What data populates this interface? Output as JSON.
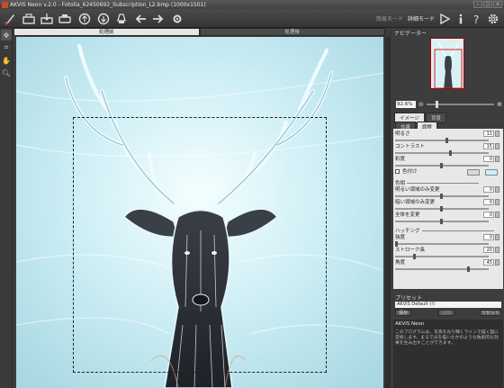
{
  "window": {
    "title": "AKVIS Neon v.2.0 - Fotolia_62450692_Subscription_L2.bmp (1000x1501)"
  },
  "toolbar": {
    "icons": [
      "logo-icon",
      "open-icon",
      "save-icon",
      "print-icon",
      "upload-icon",
      "share-icon",
      "brush-icon",
      "back-icon",
      "forward-icon",
      "run-icon",
      "info-icon",
      "help-icon",
      "settings-icon"
    ],
    "mode_simple": "簡易モード",
    "mode_advanced": "詳細モード"
  },
  "canvas_tabs": {
    "before": "処理前",
    "after": "処理後"
  },
  "navigator": {
    "title": "ナビゲーター",
    "zoom": "92.6%"
  },
  "panel_tabs": {
    "image": "イメージ",
    "background": "背景"
  },
  "sub_tabs": {
    "effect": "効果",
    "adjust": "調整"
  },
  "settings": {
    "brightness": {
      "label": "明るさ",
      "value": "11"
    },
    "contrast": {
      "label": "コントラスト",
      "value": "15"
    },
    "saturation": {
      "label": "彩度",
      "value": "0"
    },
    "tint": {
      "label": "色付け",
      "color": "#c8f0f8"
    },
    "color_section": "色相",
    "bright_hue": {
      "label": "明るい領域のみ変更",
      "value": "0"
    },
    "dark_hue": {
      "label": "暗い領域のみ変更",
      "value": "0"
    },
    "all_hue": {
      "label": "全体を変更",
      "value": "0"
    },
    "hatching_section": "ハッチング",
    "strength": {
      "label": "強度",
      "value": "0"
    },
    "stroke_length": {
      "label": "ストローク長",
      "value": "20"
    },
    "angle": {
      "label": "角度",
      "value": "45"
    }
  },
  "presets": {
    "title": "プリセット",
    "selected": "AKVIS Default (!)",
    "save": "保存",
    "delete": "削除",
    "reset": "リセット"
  },
  "info": {
    "title": "AKVIS Neon",
    "text": "このプログラムは、写真を光り輝くラインで描く図に変換します。まるで光を描いたかのような独創的な効果を生み出すことができます。"
  }
}
